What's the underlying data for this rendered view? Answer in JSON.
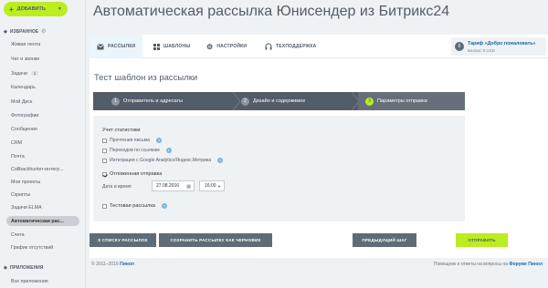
{
  "sidebar": {
    "add_button": "ДОБАВИТЬ",
    "favorites_header": "ИЗБРАННОЕ",
    "items": [
      {
        "label": "Живая лента"
      },
      {
        "label": "Чат и звонки"
      },
      {
        "label": "Задачи",
        "badge": "1"
      },
      {
        "label": "Календарь"
      },
      {
        "label": "Мой Диск"
      },
      {
        "label": "Фотографии"
      },
      {
        "label": "Сообщения"
      },
      {
        "label": "CRM"
      },
      {
        "label": "Почта"
      },
      {
        "label": "Callbackhunter-интегр..."
      },
      {
        "label": "Мои проекты"
      },
      {
        "label": "Скрипты"
      },
      {
        "label": "Задачи ELMA"
      },
      {
        "label": "Автоматическая рас..."
      },
      {
        "label": "Счета"
      },
      {
        "label": "График отсутствий"
      }
    ],
    "apps_header": "ПРИЛОЖЕНИЯ",
    "apps_items": [
      {
        "label": "Все приложения"
      }
    ]
  },
  "header": {
    "title": "Автоматическая рассылка Юнисендер из Битрикс24"
  },
  "tabs": [
    {
      "label": "РАССЫЛКИ",
      "icon": "mail-icon"
    },
    {
      "label": "ШАБЛОНЫ",
      "icon": "grid-icon"
    },
    {
      "label": "НАСТРОЙКИ",
      "icon": "gear-icon"
    },
    {
      "label": "ТЕХПОДДЕРЖКА",
      "icon": "headset-icon"
    }
  ],
  "tariff": {
    "badge": "6",
    "name": "Тариф «Добро пожаловать»",
    "balance": "Баланс 0 USD"
  },
  "subtitle": "Тест шаблон из рассылки",
  "steps": [
    {
      "num": "1",
      "label": "Отправитель и адресаты"
    },
    {
      "num": "2",
      "label": "Дизайн и содержимое"
    },
    {
      "num": "3",
      "label": "Параметры отправки"
    }
  ],
  "form": {
    "stats_header": "Учет статистики",
    "stats": [
      {
        "label": "Прочтения письма",
        "checked": false
      },
      {
        "label": "Переходов по ссылкам",
        "checked": false
      },
      {
        "label": "Интеграция с Google Analytics/Яндекс.Метрика",
        "checked": false
      }
    ],
    "deferred_label": "Отложенная отправка",
    "deferred_checked": true,
    "date_label": "Дата и время",
    "date_value": "27.08.2016",
    "time_value": "16:00",
    "test_label": "Тестовая рассылка"
  },
  "buttons": {
    "to_list": "К СПИСКУ РАССЫЛОК",
    "save_draft": "СОХРАНИТЬ РАССЫЛКУ КАК ЧЕРНОВИК",
    "prev_step": "ПРЕДЫДУЩИЙ ШАГ",
    "send": "ОТПРАВИТЬ"
  },
  "footer": {
    "copyright_prefix": "© 2011–2016",
    "copyright_link": "Пинол",
    "help_text": "Помощник и ответы на вопросы на",
    "help_link": "Форуме Пинол"
  },
  "colors": {
    "accent_green": "#bbed21",
    "dark_slate": "#535c69",
    "link_blue": "#2067b0"
  }
}
